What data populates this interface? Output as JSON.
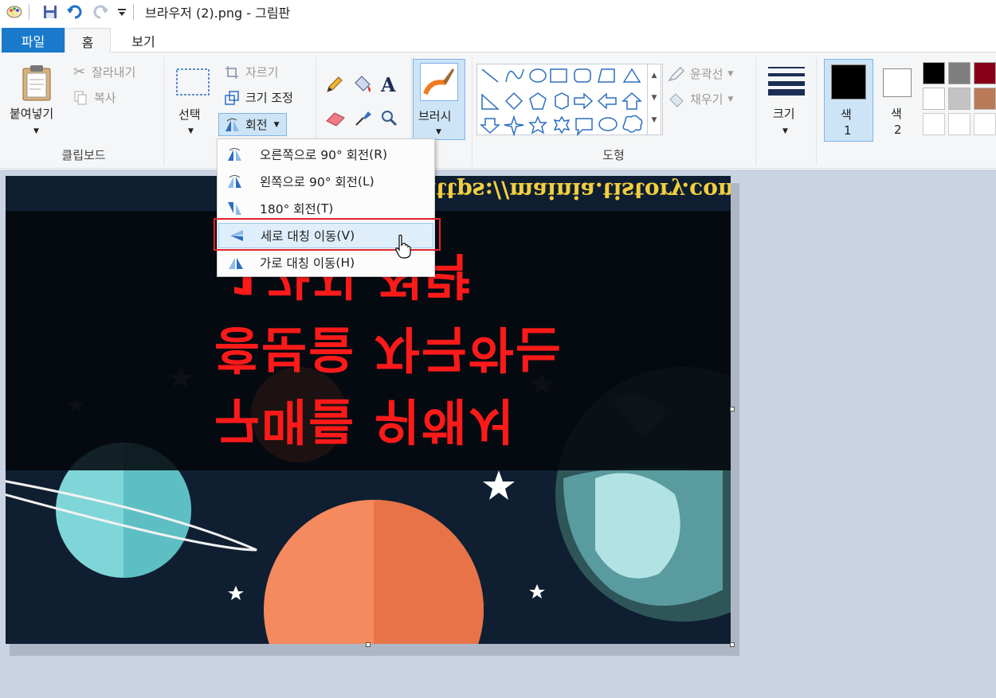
{
  "titlebar": {
    "title": "브라우저 (2).png - 그림판"
  },
  "tabs": {
    "file": "파일",
    "home": "홈",
    "view": "보기"
  },
  "clipboard": {
    "paste": "붙여넣기",
    "cut": "잘라내기",
    "copy": "복사",
    "group_label": "클립보드"
  },
  "image_group": {
    "select": "선택",
    "crop": "자르기",
    "resize": "크기 조정",
    "rotate": "회전"
  },
  "brushes": {
    "label": "브러시"
  },
  "shapes": {
    "outline": "윤곽선",
    "fill": "채우기",
    "group_label": "도형"
  },
  "size": {
    "label": "크기"
  },
  "colors": {
    "color1_label": "색",
    "color1_num": "1",
    "color2_label": "색",
    "color2_num": "2",
    "color1_value": "#000000",
    "color2_value": "#ffffff",
    "palette": [
      "#000000",
      "#7f7f7f",
      "#880015",
      "#ffffff",
      "#c3c3c3",
      "#b97a57",
      "#ffffff",
      "#ffffff",
      "#ffffff"
    ]
  },
  "rotate_menu": {
    "items": [
      {
        "label": "오른쪽으로 90° 회전",
        "key": "(R)"
      },
      {
        "label": "왼쪽으로 90° 회전",
        "key": "(L)"
      },
      {
        "label": "180° 회전",
        "key": "(T)"
      },
      {
        "label": "세로 대칭 이동",
        "key": "(V)"
      },
      {
        "label": "가로 대칭 이동",
        "key": "(H)"
      }
    ]
  },
  "image_content": {
    "url": "https://mainia.tistory.com",
    "line1": "구매를 위해서",
    "line2": "흥분을 자극하는",
    "line3": "1가지 전략"
  }
}
